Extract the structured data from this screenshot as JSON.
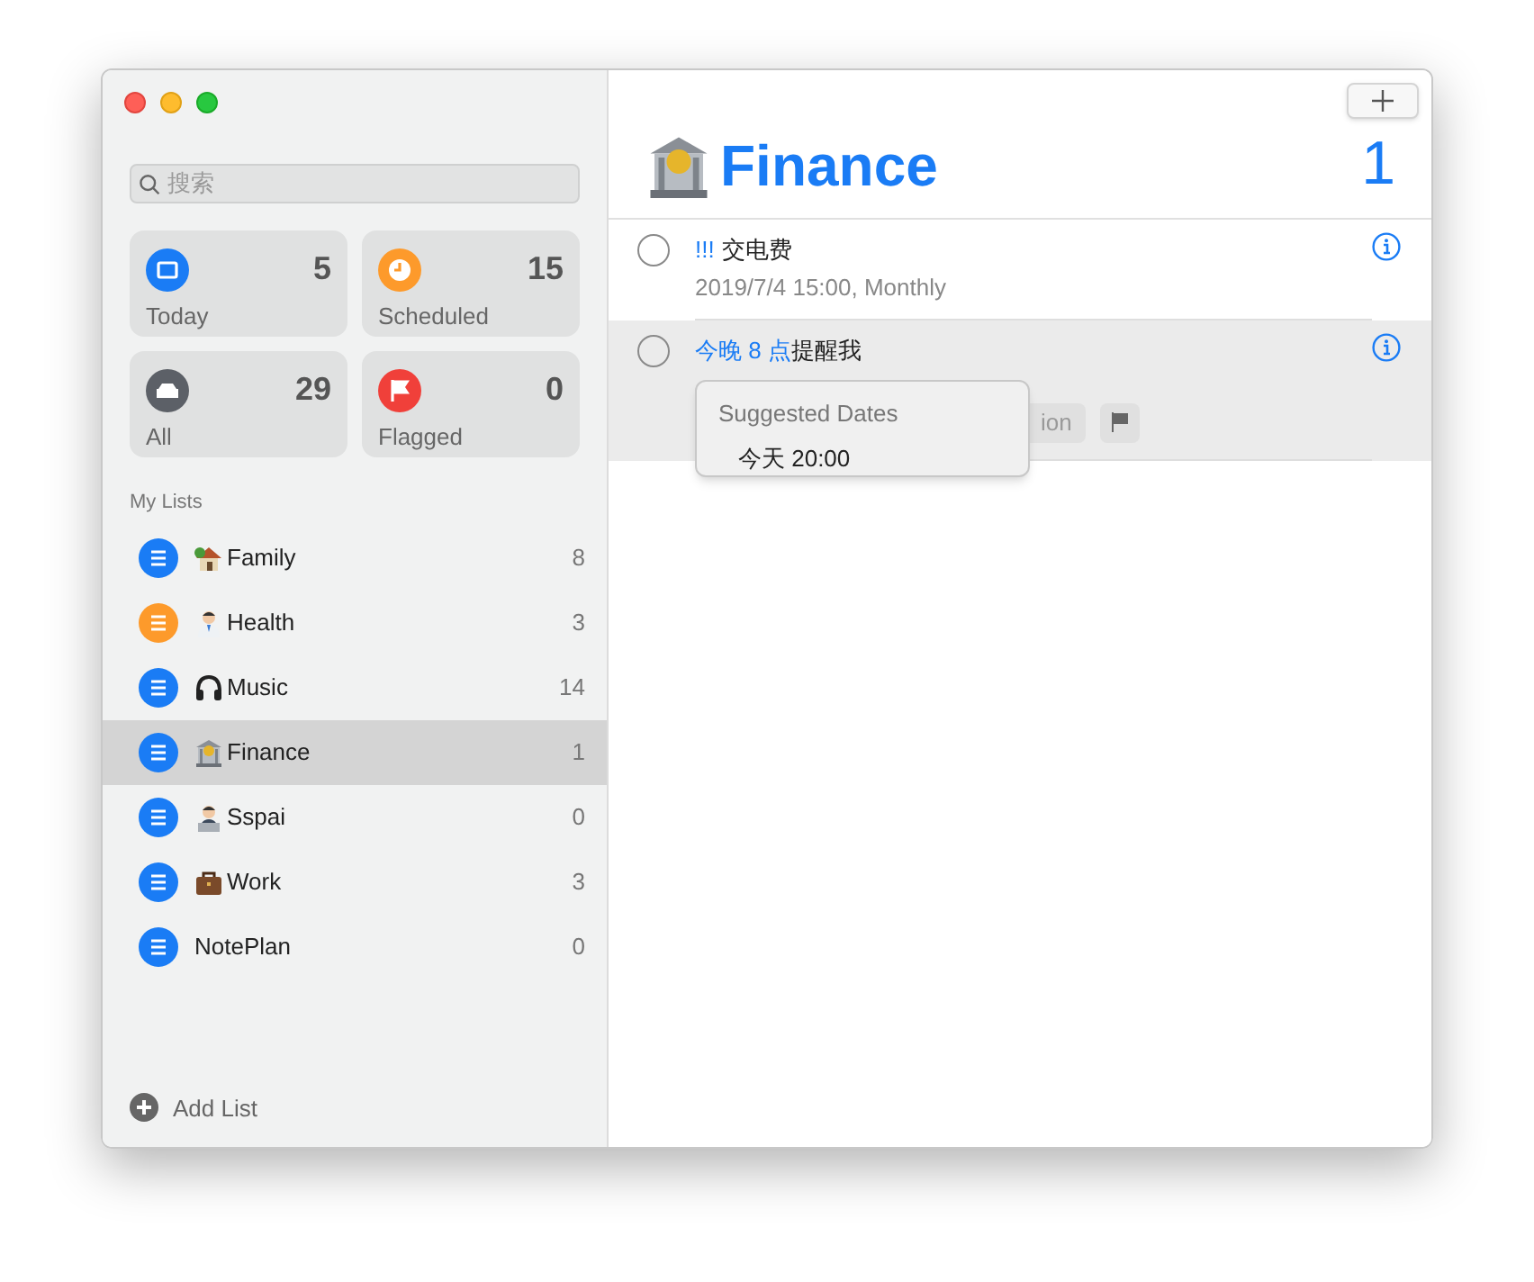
{
  "search": {
    "placeholder": "搜索"
  },
  "smart_lists": [
    {
      "kind": "today",
      "label": "Today",
      "count": "5"
    },
    {
      "kind": "scheduled",
      "label": "Scheduled",
      "count": "15"
    },
    {
      "kind": "all",
      "label": "All",
      "count": "29"
    },
    {
      "kind": "flagged",
      "label": "Flagged",
      "count": "0"
    }
  ],
  "my_lists_heading": "My Lists",
  "lists": [
    {
      "name": "Family",
      "kind": "house",
      "count": "8",
      "color": "#1a7cf5",
      "selected": false
    },
    {
      "name": "Health",
      "kind": "doctor",
      "count": "3",
      "color": "#fd9a2b",
      "selected": false
    },
    {
      "name": "Music",
      "kind": "headphones",
      "count": "14",
      "color": "#1a7cf5",
      "selected": false
    },
    {
      "name": "Finance",
      "kind": "bank",
      "count": "1",
      "color": "#1a7cf5",
      "selected": true
    },
    {
      "name": "Sspai",
      "kind": "technologist",
      "count": "0",
      "color": "#1a7cf5",
      "selected": false
    },
    {
      "name": "Work",
      "kind": "briefcase",
      "count": "3",
      "color": "#1a7cf5",
      "selected": false
    },
    {
      "name": "NotePlan",
      "kind": "plain",
      "count": "0",
      "color": "#1a7cf5",
      "selected": false
    }
  ],
  "add_list": "Add List",
  "header": {
    "kind": "bank",
    "title": "Finance",
    "count": "1"
  },
  "reminders": [
    {
      "priority": "!!!",
      "title": "交电费",
      "detail": "2019/7/4 15:00, Monthly",
      "selected": false
    },
    {
      "title": "提醒我",
      "highlight": "今晚 8 点",
      "selected": true,
      "chips": [
        {
          "kind": "text",
          "label": "ion"
        },
        {
          "kind": "flag"
        }
      ]
    }
  ],
  "popup": {
    "heading": "Suggested Dates",
    "option": "今天 20:00"
  }
}
